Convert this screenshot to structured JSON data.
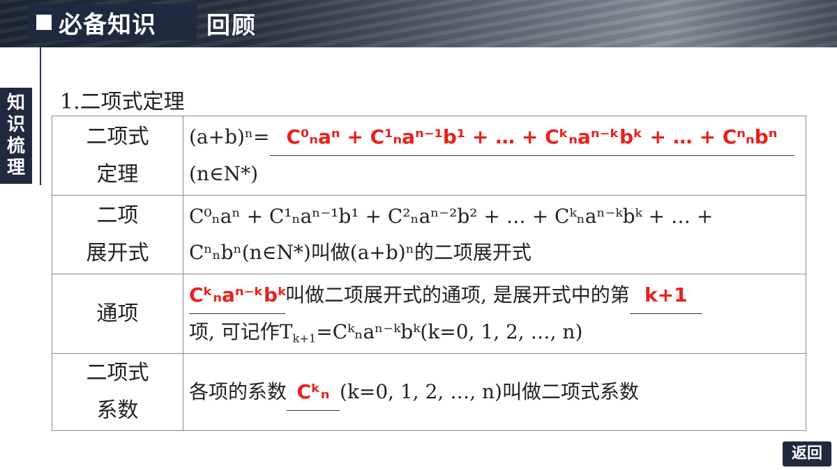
{
  "header": {
    "title": "必备知识",
    "subtitle": "回顾"
  },
  "sidebar": {
    "tab_chars": [
      "知",
      "识",
      "梳",
      "理"
    ]
  },
  "section": {
    "heading": "1.二项式定理"
  },
  "table": {
    "rows": [
      {
        "label_lines": [
          "二项式",
          "定理"
        ],
        "prefix": "(a+b)ⁿ=",
        "answer": "C⁰ₙaⁿ + C¹ₙaⁿ⁻¹b¹ + … + Cᵏₙaⁿ⁻ᵏbᵏ + … + Cⁿₙbⁿ",
        "suffix": "(n∈N*)"
      },
      {
        "label_lines": [
          "二项",
          "展开式"
        ],
        "line1": "C⁰ₙaⁿ + C¹ₙaⁿ⁻¹b¹ + C²ₙaⁿ⁻²b² + … + Cᵏₙaⁿ⁻ᵏbᵏ + … +",
        "line2_text": "叫做(a+b)ⁿ的二项展开式",
        "line2_pre": "Cⁿₙbⁿ(n∈N*)"
      },
      {
        "label_lines": [
          "通项"
        ],
        "answer1": "Cᵏₙaⁿ⁻ᵏbᵏ",
        "text1": "叫做二项展开式的通项, 是展开式中的第",
        "answer2": "k+1",
        "text2": "项, 可记作T",
        "text2_sub": "k+1",
        "text2_rest": "=Cᵏₙaⁿ⁻ᵏbᵏ(k=0, 1, 2, …, n)"
      },
      {
        "label_lines": [
          "二项式",
          "系数"
        ],
        "text_pre": "各项的系数",
        "answer": "Cᵏₙ",
        "text_post": "(k=0, 1, 2, …, n)叫做二项式系数"
      }
    ]
  },
  "footer": {
    "back_label": "返回"
  },
  "colors": {
    "accent_red": "#e8211b",
    "navy": "#1f2a40"
  }
}
